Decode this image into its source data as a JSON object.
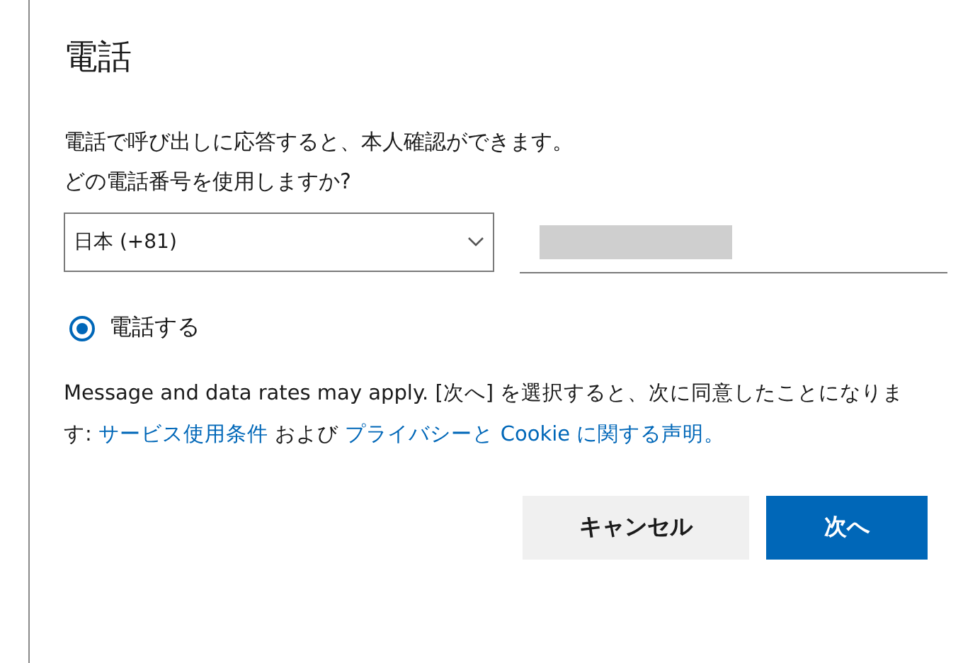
{
  "title": "電話",
  "description": "電話で呼び出しに応答すると、本人確認ができます。",
  "question": "どの電話番号を使用しますか?",
  "country_select": {
    "value": "日本 (+81)"
  },
  "phone_field": {
    "redacted": true
  },
  "options": [
    {
      "label": "電話する",
      "selected": true
    }
  ],
  "notice": {
    "text": "Message and data rates may apply. [次へ] を選択すると、次に同意したことになります: ",
    "links": [
      "サービス使用条件",
      "プライバシーと Cookie に関する声明。"
    ],
    "joiner": " および "
  },
  "buttons": [
    {
      "label": "キャンセル",
      "kind": "secondary"
    },
    {
      "label": "次へ",
      "kind": "primary"
    }
  ]
}
